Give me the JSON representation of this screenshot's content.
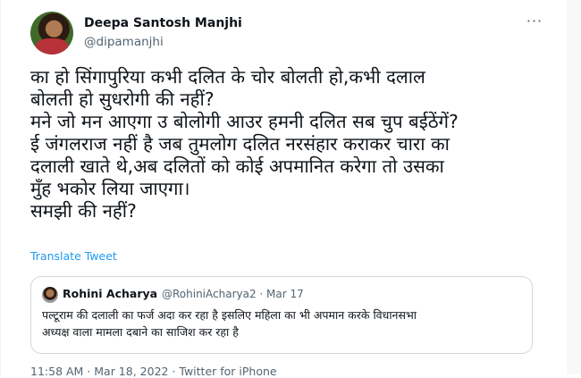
{
  "tweet": {
    "author_name": "Deepa Santosh Manjhi",
    "author_handle": "@dipamanjhi",
    "more_icon": "more-dots-icon",
    "text_lines": [
      "का हो सिंगापुरिया कभी दलित के चोर बोलती हो,कभी दलाल",
      "बोलती हो सुधरोगी की नहीं?",
      "मने जो मन आएगा उ बोलोगी आउर हमनी दलित सब चुप बईठेंगें?",
      "ई जंगलराज नहीं है जब तुमलोग दलित नरसंहार कराकर चारा का",
      "दलाली खाते थे,अब दलितों को कोई अपमानित करेगा तो उसका",
      "मुँह भकोर लिया जाएगा।",
      "समझी की नहीं?"
    ],
    "translate_label": "Translate Tweet",
    "footer_text": "11:58 AM · Mar 18, 2022 · Twitter for iPhone"
  },
  "quoted": {
    "author_name": "Rohini Acharya",
    "meta": "@RohiniAcharya2 · Mar 17",
    "text_lines": [
      "पल्टूराम की दलाली का फर्ज अदा कर रहा है इसलिए महिला का भी अपमान करके विधानसभा",
      "अध्यक्ष वाला मामला दबाने का साजिश कर रहा है"
    ]
  },
  "colors": {
    "link": "#1d9bf0",
    "secondary_text": "#536471",
    "border": "#cfd9de"
  }
}
